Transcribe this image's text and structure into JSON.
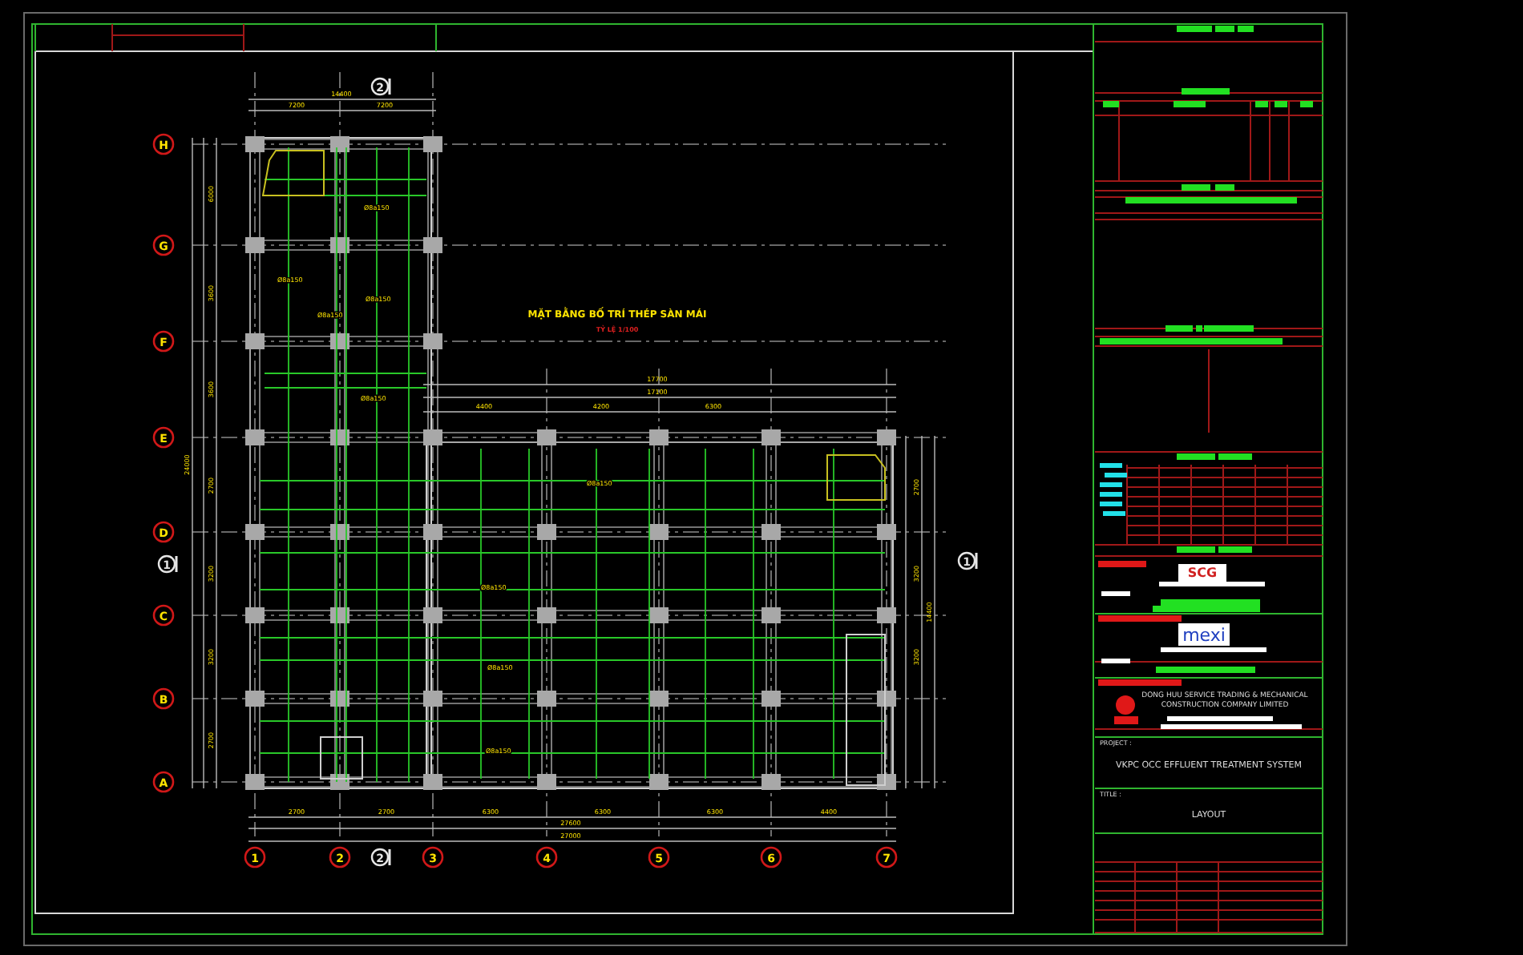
{
  "plan": {
    "title": "MẶT BẰNG BỐ TRÍ THÉP SÀN MÁI",
    "scale": "TỶ LỆ 1/100",
    "row_axes": [
      {
        "label": "H"
      },
      {
        "label": "G"
      },
      {
        "label": "F"
      },
      {
        "label": "E"
      },
      {
        "label": "D"
      },
      {
        "label": "C"
      },
      {
        "label": "B"
      },
      {
        "label": "A"
      }
    ],
    "column_axes": [
      {
        "label": "1"
      },
      {
        "label": "2"
      },
      {
        "label": "3"
      },
      {
        "label": "4"
      },
      {
        "label": "5"
      },
      {
        "label": "6"
      },
      {
        "label": "7"
      }
    ],
    "section_marks": [
      {
        "label": "2"
      },
      {
        "label": "2"
      },
      {
        "label": "1"
      },
      {
        "label": "1"
      }
    ],
    "top_dimensions": [
      "14400",
      "7200",
      "7200",
      "17700",
      "17100",
      "4400",
      "4200",
      "6300"
    ],
    "bottom_dimensions": [
      "2700",
      "2700",
      "6300",
      "6300",
      "6300",
      "4400",
      "27600",
      "27000"
    ],
    "left_dimensions": [
      "6000",
      "3600",
      "3600",
      "2700",
      "3200",
      "3200",
      "2700",
      "24000"
    ],
    "right_dimensions": [
      "2700",
      "3200",
      "3200",
      "14400"
    ],
    "rebar_labels": [
      "Ø8a150",
      "Ø8a150",
      "Ø8a150",
      "Ø8a150",
      "Ø8a150",
      "Ø8a150",
      "Ø8a150",
      "Ø8a150",
      "Ø8a150"
    ]
  },
  "title_block": {
    "logos": [
      {
        "kind": "scg",
        "text": "SCG"
      },
      {
        "kind": "mexi",
        "text": "mexi"
      }
    ],
    "company_name": [
      "DONG HUU SERVICE TRADING & MECHANICAL",
      "CONSTRUCTION COMPANY LIMITED"
    ],
    "project_label": "PROJECT :",
    "project_name": "VKPC OCC EFFLUENT TREATMENT SYSTEM",
    "title_label": "TITLE :",
    "title": "LAYOUT"
  }
}
